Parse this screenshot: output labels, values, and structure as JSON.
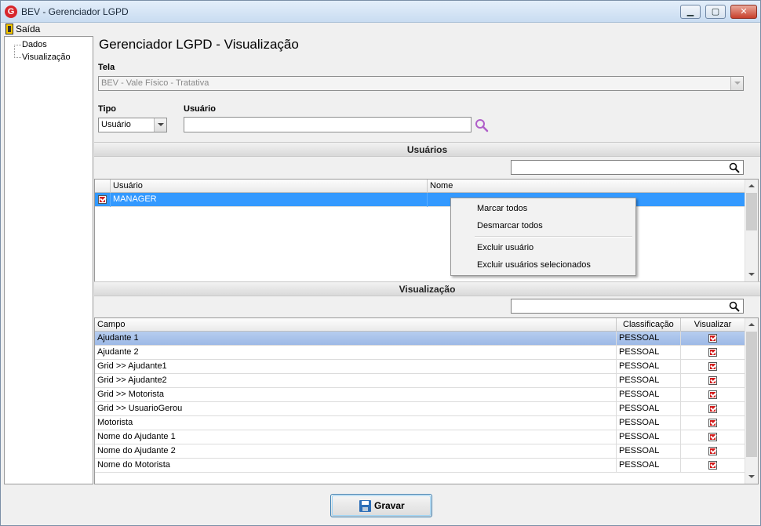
{
  "window": {
    "title": "BEV - Gerenciador LGPD",
    "minimize": "▁",
    "maximize": "▢",
    "close": "✕"
  },
  "menu": {
    "exit_label": "Saída"
  },
  "tree": {
    "items": [
      {
        "label": "Dados"
      },
      {
        "label": "Visualização"
      }
    ]
  },
  "page": {
    "title": "Gerenciador LGPD - Visualização"
  },
  "form": {
    "tela_label": "Tela",
    "tela_value": "BEV - Vale Físico - Tratativa",
    "tipo_label": "Tipo",
    "tipo_value": "Usuário",
    "usuario_label": "Usuário",
    "usuario_value": ""
  },
  "users_section": {
    "title": "Usuários",
    "filter_value": "",
    "columns": [
      "Usuário",
      "Nome"
    ],
    "rows": [
      {
        "checked": true,
        "usuario": "MANAGER",
        "nome": ""
      }
    ]
  },
  "context_menu": {
    "items": [
      "Marcar todos",
      "Desmarcar todos",
      "Excluir usuário",
      "Excluir usuários selecionados"
    ]
  },
  "view_section": {
    "title": "Visualização",
    "filter_value": "",
    "columns": [
      "Campo",
      "Classificação",
      "Visualizar"
    ],
    "rows": [
      {
        "campo": "Ajudante 1",
        "classificacao": "PESSOAL",
        "visualizar": true
      },
      {
        "campo": "Ajudante 2",
        "classificacao": "PESSOAL",
        "visualizar": true
      },
      {
        "campo": "Grid >> Ajudante1",
        "classificacao": "PESSOAL",
        "visualizar": true
      },
      {
        "campo": "Grid >> Ajudante2",
        "classificacao": "PESSOAL",
        "visualizar": true
      },
      {
        "campo": "Grid >> Motorista",
        "classificacao": "PESSOAL",
        "visualizar": true
      },
      {
        "campo": "Grid >> UsuarioGerou",
        "classificacao": "PESSOAL",
        "visualizar": true
      },
      {
        "campo": "Motorista",
        "classificacao": "PESSOAL",
        "visualizar": true
      },
      {
        "campo": "Nome do Ajudante 1",
        "classificacao": "PESSOAL",
        "visualizar": true
      },
      {
        "campo": "Nome do Ajudante 2",
        "classificacao": "PESSOAL",
        "visualizar": true
      },
      {
        "campo": "Nome do Motorista",
        "classificacao": "PESSOAL",
        "visualizar": true
      }
    ]
  },
  "actions": {
    "save_label": "Gravar"
  },
  "colors": {
    "selection": "#3399ff",
    "checkbox": "#d21c1c",
    "search_icon": "#b05fc9"
  },
  "icons": {
    "app": "bev-logo-icon",
    "exit": "exit-door-icon",
    "search": "search-icon",
    "save": "floppy-disk-icon"
  }
}
